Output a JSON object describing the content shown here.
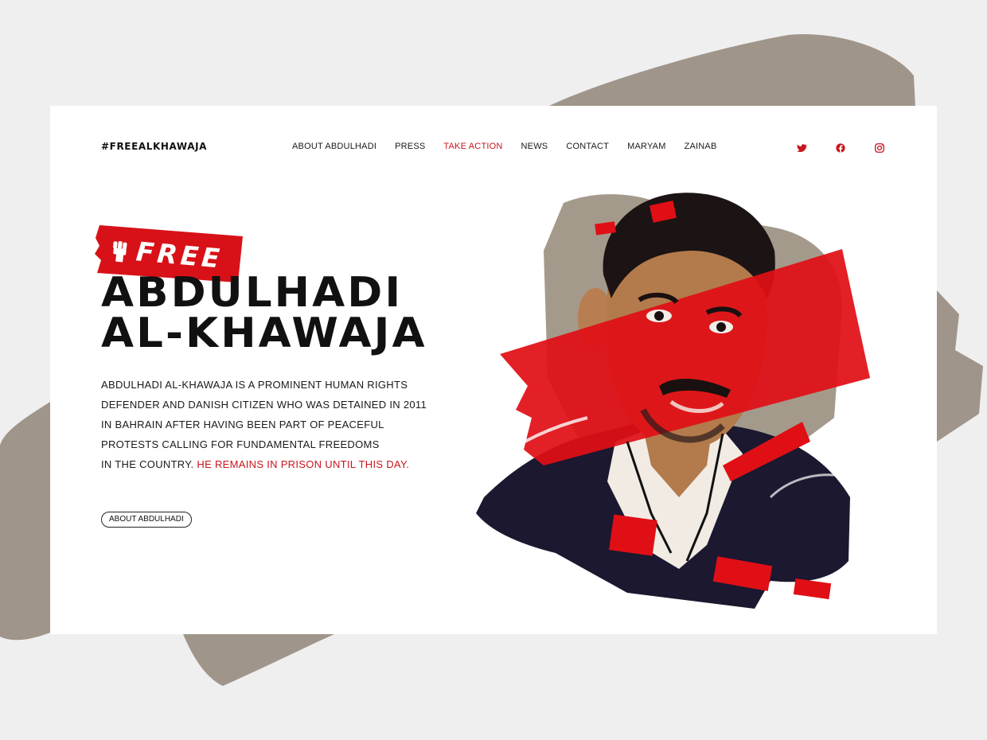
{
  "brand": {
    "logo": "#FREEALKHAWAJA"
  },
  "nav": {
    "items": [
      {
        "label": "ABOUT ABDULHADI",
        "active": false
      },
      {
        "label": "PRESS",
        "active": false
      },
      {
        "label": "TAKE ACTION",
        "active": true
      },
      {
        "label": "NEWS",
        "active": false
      },
      {
        "label": "CONTACT",
        "active": false
      },
      {
        "label": "MARYAM",
        "active": false
      },
      {
        "label": "ZAINAB",
        "active": false
      }
    ]
  },
  "social": {
    "icons": [
      "twitter-icon",
      "facebook-icon",
      "instagram-icon"
    ],
    "color": "#c8161d"
  },
  "hero": {
    "tag": "FREE",
    "title_line1": "ABDULHADI",
    "title_line2": "AL-KHAWAJA",
    "description_lines": [
      "ABDULHADI AL-KHAWAJA IS A PROMINENT HUMAN RIGHTS",
      "DEFENDER AND DANISH CITIZEN WHO WAS DETAINED IN 2011",
      "IN BAHRAIN AFTER HAVING BEEN PART OF PEACEFUL",
      "PROTESTS CALLING FOR FUNDAMENTAL FREEDOMS",
      "IN THE COUNTRY."
    ],
    "description_highlight": "HE REMAINS IN PRISON UNTIL THIS DAY.",
    "button_label": "ABOUT ABDULHADI"
  },
  "colors": {
    "accent": "#c8161d",
    "text": "#111111",
    "background": "#efefef",
    "brush": "#a0958a"
  }
}
